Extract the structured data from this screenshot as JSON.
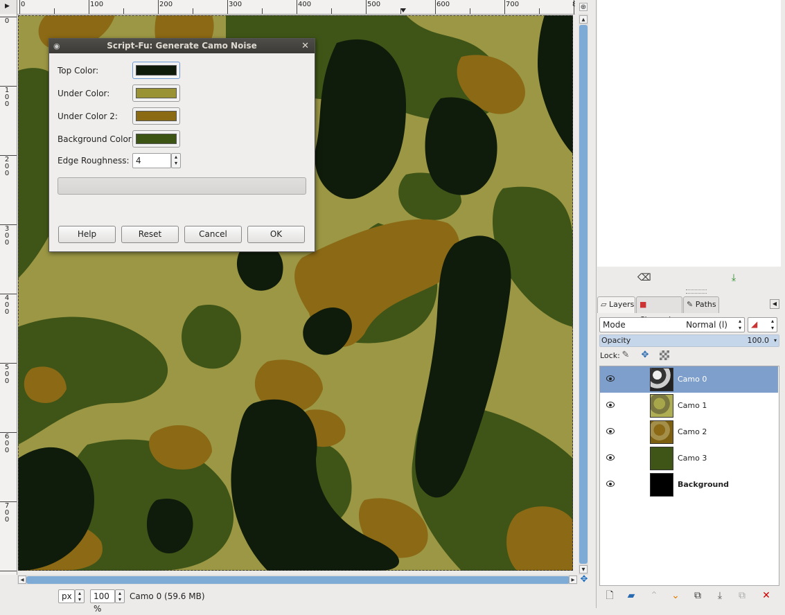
{
  "ruler": {
    "top_ticks": [
      "0",
      "100",
      "200",
      "300",
      "400",
      "500",
      "600",
      "700",
      "8"
    ],
    "left_ticks": [
      "0",
      "100",
      "200",
      "300",
      "400",
      "500",
      "600",
      "700"
    ]
  },
  "dialog": {
    "title": "Script-Fu: Generate Camo Noise",
    "fields": [
      {
        "label": "Top Color:",
        "color": "#0e1a0a"
      },
      {
        "label": "Under Color:",
        "color": "#9a9336"
      },
      {
        "label": "Under Color 2:",
        "color": "#8a6a12"
      },
      {
        "label": "Background Color:",
        "color": "#3c5414"
      }
    ],
    "edge_roughness_label": "Edge Roughness:",
    "edge_roughness_value": "4",
    "buttons": {
      "help": "Help",
      "reset": "Reset",
      "cancel": "Cancel",
      "ok": "OK"
    }
  },
  "statusbar": {
    "unit": "px",
    "zoom": "100 %",
    "info": "Camo 0 (59.6 MB)"
  },
  "panel": {
    "tabs": [
      "Layers",
      "Channels",
      "Paths"
    ],
    "mode_label": "Mode",
    "mode_value": "Normal (l)",
    "opacity_label": "Opacity",
    "opacity_value": "100.0",
    "opacity_fraction": 1.0,
    "lock_label": "Lock:",
    "layers": [
      {
        "name": "Camo 0",
        "selected": true
      },
      {
        "name": "Camo 1",
        "selected": false
      },
      {
        "name": "Camo 2",
        "selected": false
      },
      {
        "name": "Camo 3",
        "selected": false
      },
      {
        "name": "Background",
        "selected": false
      }
    ]
  },
  "colors": {
    "camo_dark": "#0f1c0b",
    "camo_light": "#9b9744",
    "camo_brown": "#8b6915",
    "camo_green": "#3f5517",
    "selection": "#7e9fcc"
  }
}
